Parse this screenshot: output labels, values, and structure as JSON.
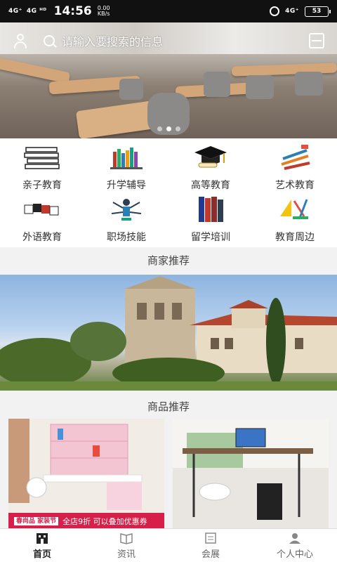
{
  "status_bar": {
    "signal_1": "4G⁺",
    "signal_2": "4G ᴴᴰ",
    "time": "14:56",
    "speed_value": "0.00",
    "speed_unit": "KB/s",
    "right_signal": "4G⁺",
    "battery": "53"
  },
  "header": {
    "search_placeholder": "请输入要搜索的信息"
  },
  "carousel": {
    "dot_count": 3,
    "active_index": 1
  },
  "categories": [
    {
      "label": "亲子教育",
      "icon": "books-stack-icon"
    },
    {
      "label": "升学辅导",
      "icon": "bookshelf-icon"
    },
    {
      "label": "高等教育",
      "icon": "graduation-cap-icon"
    },
    {
      "label": "艺术教育",
      "icon": "pencils-icon"
    },
    {
      "label": "外语教育",
      "icon": "language-blocks-icon"
    },
    {
      "label": "职场技能",
      "icon": "multitask-person-icon"
    },
    {
      "label": "留学培训",
      "icon": "book-row-icon"
    },
    {
      "label": "教育周边",
      "icon": "stationery-icon"
    }
  ],
  "sections": {
    "merchant_title": "商家推荐",
    "product_title": "商品推荐"
  },
  "products": {
    "left_promo_brand": "春尚品 家装节",
    "left_promo_text": "全店9折   可以叠加优惠券"
  },
  "bottom_nav": [
    {
      "label": "首页",
      "icon": "home-icon",
      "active": true
    },
    {
      "label": "资讯",
      "icon": "news-icon",
      "active": false
    },
    {
      "label": "会展",
      "icon": "exhibition-icon",
      "active": false
    },
    {
      "label": "个人中心",
      "icon": "profile-icon",
      "active": false
    }
  ],
  "colors": {
    "promo_red": "#d6204a",
    "nav_active": "#222222"
  }
}
